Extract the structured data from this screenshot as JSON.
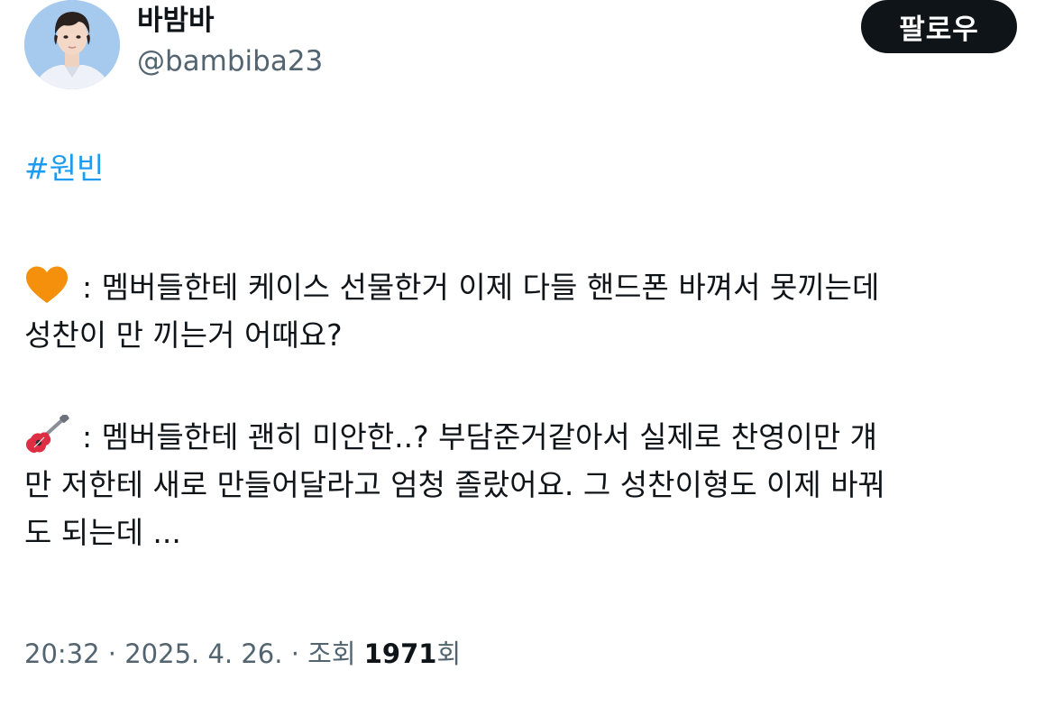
{
  "author": {
    "display_name": "바밤바",
    "handle": "@bambiba23"
  },
  "follow_button": {
    "label": "팔로우"
  },
  "tweet": {
    "hashtag": "#원빈",
    "para1": {
      "emoji": "orange-heart-icon",
      "line1": ": 멤버들한테 케이스 선물한거 이제 다들 핸드폰 바껴서 못끼는데",
      "line2": "성찬이 만 끼는거 어때요?"
    },
    "para2": {
      "emoji": "guitar-icon",
      "line1": ": 멤버들한테 괜히 미안한..? 부담준거같아서 실제로 찬영이만 걔",
      "line2": "만 저한테 새로 만들어달라고 엄청 졸랐어요. 그 성찬이형도 이제 바꿔",
      "line3": "도 되는데 ..."
    }
  },
  "meta": {
    "time": "20:32",
    "sep1": " · ",
    "date": "2025. 4. 26.",
    "sep2": " · ",
    "views_label": "조회 ",
    "views_count": "1971",
    "views_suffix": "회"
  },
  "colors": {
    "hashtag": "#1d9bf0",
    "text": "#0f1419",
    "secondary": "#536471",
    "button_bg": "#0f1419",
    "heart": "#f4900c"
  }
}
